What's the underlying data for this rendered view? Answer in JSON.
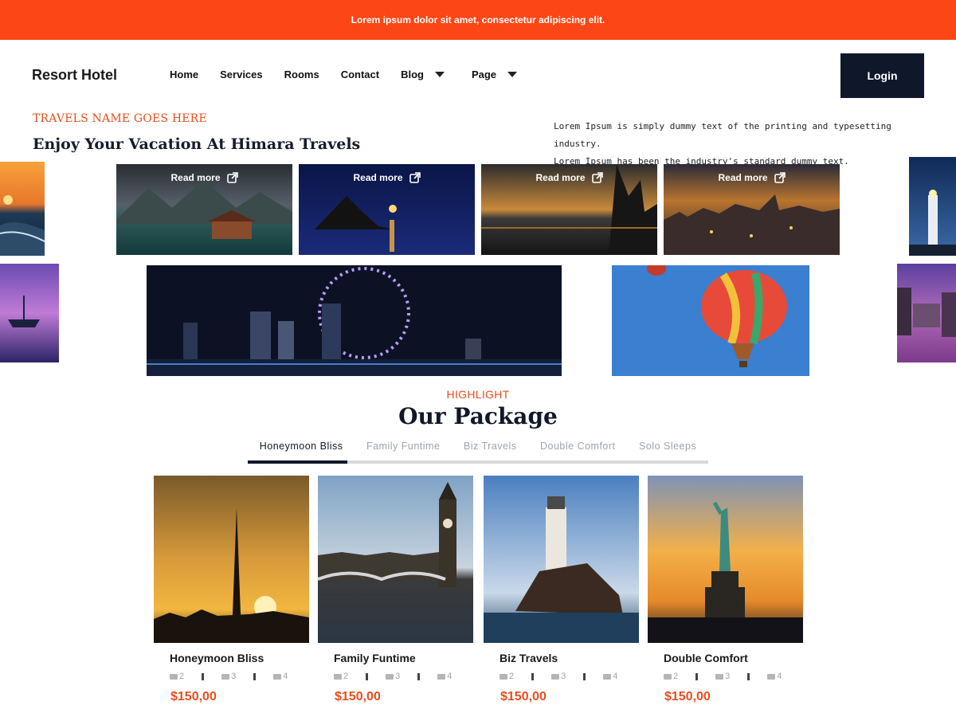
{
  "announcement": "Lorem ipsum dolor sit amet, consectetur adipiscing elit.",
  "brand": "Resort Hotel",
  "nav": [
    {
      "label": "Home",
      "dropdown": false
    },
    {
      "label": "Services",
      "dropdown": false
    },
    {
      "label": "Rooms",
      "dropdown": false
    },
    {
      "label": "Contact",
      "dropdown": false
    },
    {
      "label": "Blog",
      "dropdown": true
    },
    {
      "label": "Page",
      "dropdown": true
    }
  ],
  "login_label": "Login",
  "hero": {
    "kicker": "TRAVELS NAME GOES HERE",
    "headline": "Enjoy Your Vacation At Himara Travels",
    "intro_lines": [
      "Lorem Ipsum is simply dummy text of the printing and typesetting industry.",
      "Lorem Ipsum has been the industry's standard dummy text."
    ],
    "read_more_label": "Read more"
  },
  "package_section": {
    "kicker": "HIGHLIGHT",
    "title": "Our Package",
    "tabs": [
      "Honeymoon Bliss",
      "Family Funtime",
      "Biz Travels",
      "Double Comfort",
      "Solo Sleeps"
    ],
    "active_tab": 0
  },
  "packages": [
    {
      "title": "Honeymoon Bliss",
      "beds": "2",
      "baths": "3",
      "guests": "4",
      "price": "$150,00"
    },
    {
      "title": "Family Funtime",
      "beds": "2",
      "baths": "3",
      "guests": "4",
      "price": "$150,00"
    },
    {
      "title": "Biz Travels",
      "beds": "2",
      "baths": "3",
      "guests": "4",
      "price": "$150,00"
    },
    {
      "title": "Double Comfort",
      "beds": "2",
      "baths": "3",
      "guests": "4",
      "price": "$150,00"
    }
  ],
  "colors": {
    "accent": "#fc4616",
    "dark": "#0f172a",
    "price": "#e94e1b"
  }
}
